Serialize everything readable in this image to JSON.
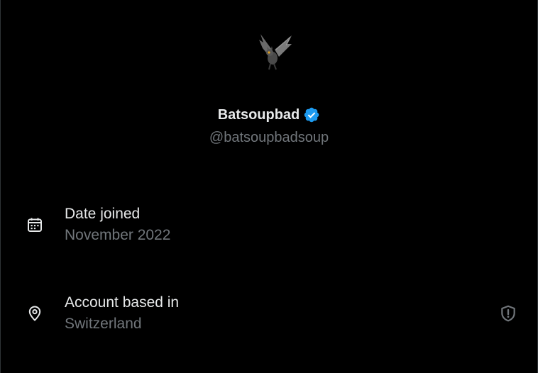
{
  "profile": {
    "display_name": "Batsoupbad",
    "handle": "@batsoupbadsoup",
    "verified_icon": "verified-badge-icon",
    "verified_color": "#1d9bf0"
  },
  "details": {
    "joined": {
      "label": "Date joined",
      "value": "November 2022",
      "icon": "calendar-icon"
    },
    "location": {
      "label": "Account based in",
      "value": "Switzerland",
      "icon": "location-pin-icon",
      "info_icon": "shield-alert-icon"
    }
  },
  "colors": {
    "background": "#000000",
    "primary_text": "#e7e9ea",
    "secondary_text": "#71767b"
  }
}
